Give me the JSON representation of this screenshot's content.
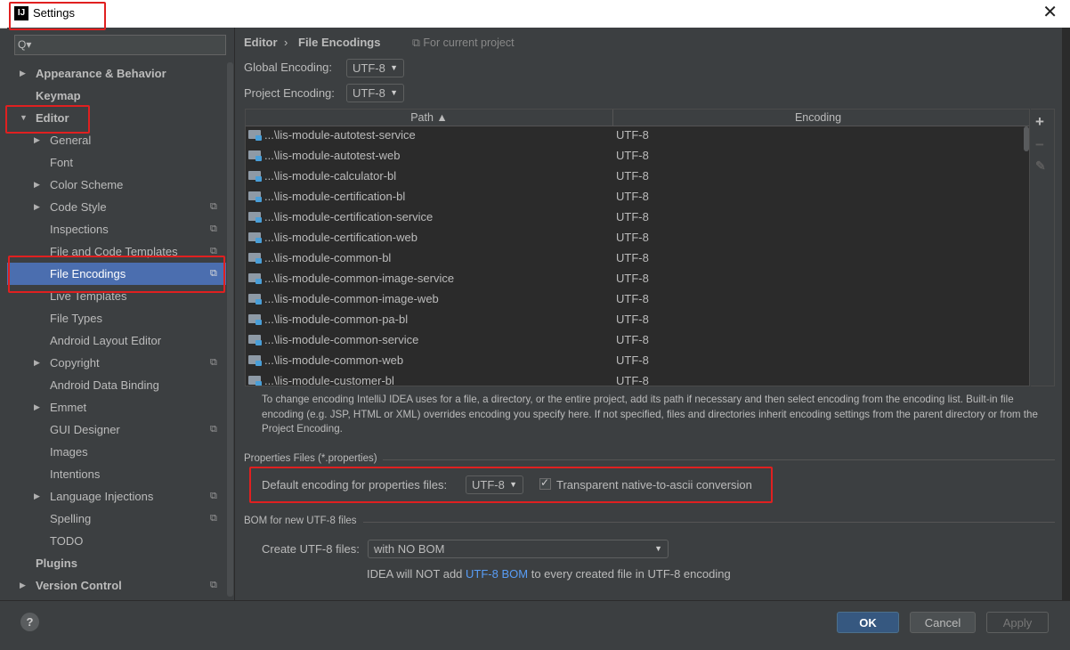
{
  "window": {
    "title": "Settings",
    "icon_label": "IJ",
    "close_icon": "close-icon"
  },
  "search": {
    "placeholder": "Q▾"
  },
  "sidebar": {
    "items": [
      {
        "label": "Appearance & Behavior",
        "bold": true,
        "arrow": "▶"
      },
      {
        "label": "Keymap",
        "bold": true
      },
      {
        "label": "Editor",
        "bold": true,
        "arrow": "▼"
      },
      {
        "label": "General",
        "arrow": "▶"
      },
      {
        "label": "Font"
      },
      {
        "label": "Color Scheme",
        "arrow": "▶"
      },
      {
        "label": "Code Style",
        "arrow": "▶",
        "project": true
      },
      {
        "label": "Inspections",
        "project": true
      },
      {
        "label": "File and Code Templates",
        "project": true
      },
      {
        "label": "File Encodings",
        "project": true,
        "selected": true
      },
      {
        "label": "Live Templates"
      },
      {
        "label": "File Types"
      },
      {
        "label": "Android Layout Editor"
      },
      {
        "label": "Copyright",
        "arrow": "▶",
        "project": true
      },
      {
        "label": "Android Data Binding"
      },
      {
        "label": "Emmet",
        "arrow": "▶"
      },
      {
        "label": "GUI Designer",
        "project": true
      },
      {
        "label": "Images"
      },
      {
        "label": "Intentions"
      },
      {
        "label": "Language Injections",
        "arrow": "▶",
        "project": true
      },
      {
        "label": "Spelling",
        "project": true
      },
      {
        "label": "TODO"
      },
      {
        "label": "Plugins",
        "bold": true
      },
      {
        "label": "Version Control",
        "bold": true,
        "arrow": "▶",
        "project": true
      }
    ]
  },
  "breadcrumb": {
    "parent": "Editor",
    "separator": "›",
    "current": "File Encodings",
    "scope": "For current project"
  },
  "global_encoding": {
    "label": "Global Encoding:",
    "value": "UTF-8"
  },
  "project_encoding": {
    "label": "Project Encoding:",
    "value": "UTF-8"
  },
  "table": {
    "columns": {
      "path": "Path ▲",
      "encoding": "Encoding"
    },
    "rows": [
      {
        "path": "...\\lis-module-autotest-service",
        "encoding": "UTF-8"
      },
      {
        "path": "...\\lis-module-autotest-web",
        "encoding": "UTF-8"
      },
      {
        "path": "...\\lis-module-calculator-bl",
        "encoding": "UTF-8"
      },
      {
        "path": "...\\lis-module-certification-bl",
        "encoding": "UTF-8"
      },
      {
        "path": "...\\lis-module-certification-service",
        "encoding": "UTF-8"
      },
      {
        "path": "...\\lis-module-certification-web",
        "encoding": "UTF-8"
      },
      {
        "path": "...\\lis-module-common-bl",
        "encoding": "UTF-8"
      },
      {
        "path": "...\\lis-module-common-image-service",
        "encoding": "UTF-8"
      },
      {
        "path": "...\\lis-module-common-image-web",
        "encoding": "UTF-8"
      },
      {
        "path": "...\\lis-module-common-pa-bl",
        "encoding": "UTF-8"
      },
      {
        "path": "...\\lis-module-common-service",
        "encoding": "UTF-8"
      },
      {
        "path": "...\\lis-module-common-web",
        "encoding": "UTF-8"
      },
      {
        "path": "...\\lis-module-customer-bl",
        "encoding": "UTF-8"
      }
    ],
    "toolbar": {
      "add": "+",
      "remove": "−",
      "edit": "✎"
    }
  },
  "description": "To change encoding IntelliJ IDEA uses for a file, a directory, or the entire project, add its path if necessary and then select encoding from the encoding list. Built-in file encoding (e.g. JSP, HTML or XML) overrides encoding you specify here. If not specified, files and directories inherit encoding settings from the parent directory or from the Project Encoding.",
  "properties": {
    "section_title": "Properties Files (*.properties)",
    "default_label": "Default encoding for properties files:",
    "default_value": "UTF-8",
    "transparent_label": "Transparent native-to-ascii conversion",
    "transparent_checked": true
  },
  "bom": {
    "section_title": "BOM for new UTF-8 files",
    "create_label": "Create UTF-8 files:",
    "create_value": "with NO BOM",
    "hint_before": "IDEA will NOT add ",
    "hint_link": "UTF-8 BOM",
    "hint_after": " to every created file in UTF-8 encoding"
  },
  "buttons": {
    "help": "?",
    "ok": "OK",
    "cancel": "Cancel",
    "apply": "Apply"
  },
  "colors": {
    "selection": "#4b6eaf",
    "annotation": "#e02020",
    "link": "#589df6",
    "ok_button": "#365880"
  }
}
